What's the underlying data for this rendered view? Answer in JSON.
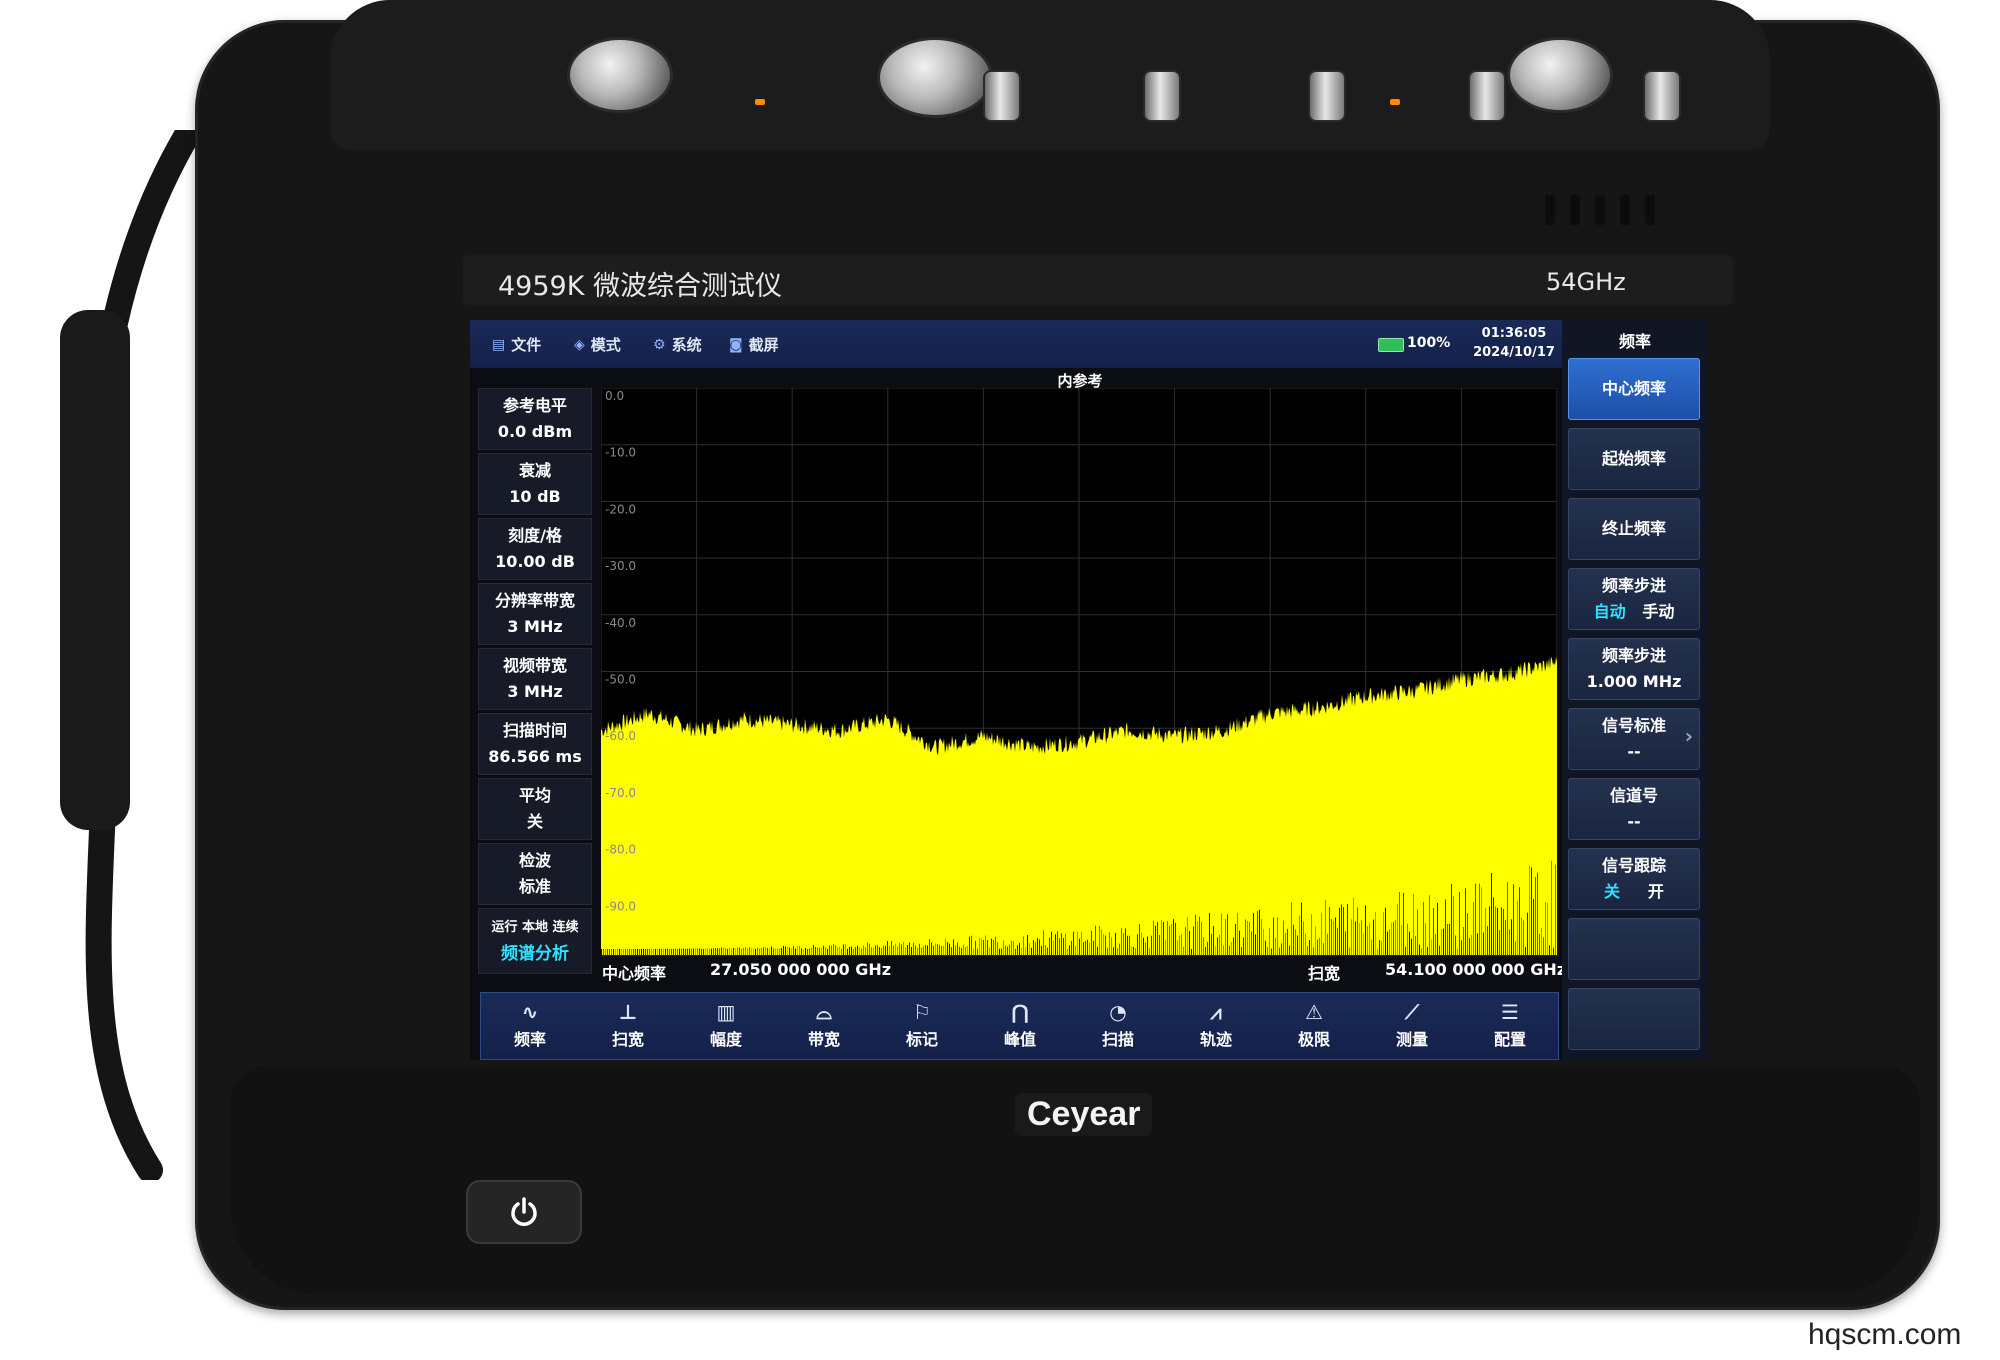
{
  "device": {
    "model_name": "4959K 微波综合测试仪",
    "freq_label": "54GHz",
    "brand": "Ceyear",
    "power_icon": "power-icon"
  },
  "menu": {
    "items": [
      {
        "label": "文件",
        "icon": "file-icon"
      },
      {
        "label": "模式",
        "icon": "layers-icon"
      },
      {
        "label": "系统",
        "icon": "gear-icon"
      },
      {
        "label": "截屏",
        "icon": "camera-icon"
      }
    ],
    "battery": "100%",
    "time": "01:36:05",
    "date": "2024/10/17"
  },
  "trace_title": "内参考",
  "left_params": [
    {
      "name": "参考电平",
      "value": "0.0 dBm"
    },
    {
      "name": "衰减",
      "value": "10 dB"
    },
    {
      "name": "刻度/格",
      "value": "10.00 dB"
    },
    {
      "name": "分辨率带宽",
      "value": "3 MHz"
    },
    {
      "name": "视频带宽",
      "value": "3 MHz"
    },
    {
      "name": "扫描时间",
      "value": "86.566 ms"
    },
    {
      "name": "平均",
      "value": "关"
    },
    {
      "name": "检波",
      "value": "标准"
    }
  ],
  "status": {
    "state_line": "运行 本地 连续",
    "mode": "频谱分析"
  },
  "footer": {
    "center_label": "中心频率",
    "center_value": "27.050 000 000 GHz",
    "span_label": "扫宽",
    "span_value": "54.100 000 000 GHz"
  },
  "right_panel": {
    "title": "频率",
    "keys": [
      {
        "line1": "中心频率",
        "line2": ""
      },
      {
        "line1": "起始频率",
        "line2": ""
      },
      {
        "line1": "终止频率",
        "line2": ""
      },
      {
        "line1": "频率步进",
        "opt_a": "自动",
        "opt_b": "手动"
      },
      {
        "line1": "频率步进",
        "line2": "1.000 MHz"
      },
      {
        "line1": "信号标准",
        "line2": "--"
      },
      {
        "line1": "信道号",
        "line2": "--"
      },
      {
        "line1": "信号跟踪",
        "opt_a": "关",
        "opt_b": "开"
      },
      {
        "line1": "",
        "line2": ""
      },
      {
        "line1": "",
        "line2": ""
      }
    ]
  },
  "toolbar": [
    {
      "label": "频率",
      "icon": "frequency-icon"
    },
    {
      "label": "扫宽",
      "icon": "span-icon"
    },
    {
      "label": "幅度",
      "icon": "amplitude-icon"
    },
    {
      "label": "带宽",
      "icon": "bandwidth-icon"
    },
    {
      "label": "标记",
      "icon": "marker-flag-icon"
    },
    {
      "label": "峰值",
      "icon": "peak-icon"
    },
    {
      "label": "扫描",
      "icon": "sweep-icon"
    },
    {
      "label": "轨迹",
      "icon": "trace-icon"
    },
    {
      "label": "极限",
      "icon": "limit-warning-icon"
    },
    {
      "label": "测量",
      "icon": "measure-ruler-icon"
    },
    {
      "label": "配置",
      "icon": "config-sliders-icon"
    }
  ],
  "chart_data": {
    "type": "area",
    "title": "内参考",
    "ylim": [
      -100,
      0
    ],
    "yticks": [
      "0.0",
      "-10.0",
      "-20.0",
      "-30.0",
      "-40.0",
      "-50.0",
      "-60.0",
      "-70.0",
      "-80.0",
      "-90.0"
    ],
    "xlim_ghz": [
      0,
      54.1
    ],
    "trace_color": "#ffff00",
    "grid": true,
    "series": [
      {
        "x_ghz": [
          0,
          2.7,
          5.4,
          8.1,
          10.8,
          13.5,
          16.2,
          18.9,
          21.6,
          24.3,
          27.0,
          29.8,
          32.5,
          35.2,
          37.9,
          40.6,
          43.3,
          46.0,
          48.7,
          51.4,
          54.1
        ],
        "y_dbm": [
          -61,
          -58,
          -61,
          -59,
          -60,
          -61,
          -59,
          -64,
          -62,
          -64,
          -63,
          -61,
          -62,
          -61,
          -58,
          -57,
          -55,
          -54,
          -52,
          -51,
          -49
        ]
      }
    ]
  },
  "watermark": "hqscm.com"
}
